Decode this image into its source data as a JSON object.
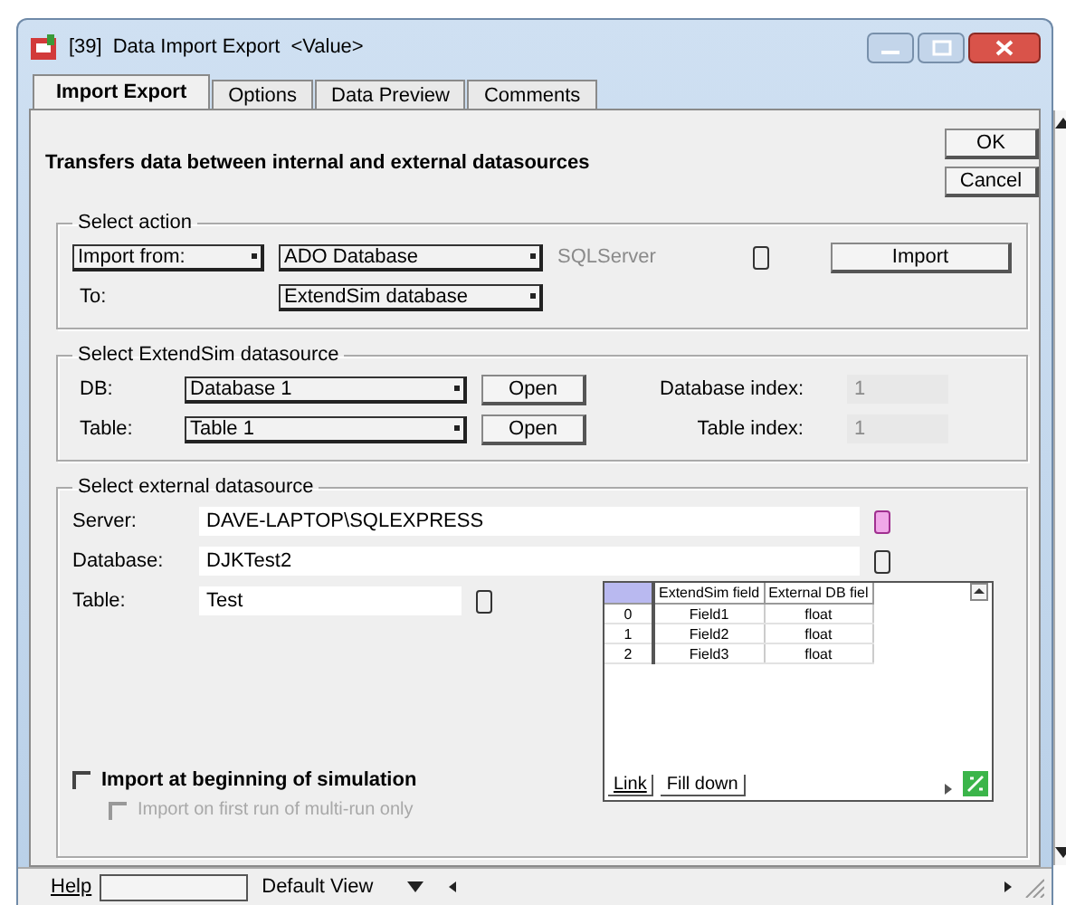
{
  "window": {
    "block_number": "[39]",
    "title": "Data Import Export",
    "value_label": "<Value>"
  },
  "tabs": [
    {
      "label": "Import Export",
      "selected": true
    },
    {
      "label": "Options",
      "selected": false
    },
    {
      "label": "Data Preview",
      "selected": false
    },
    {
      "label": "Comments",
      "selected": false
    }
  ],
  "description": "Transfers data between internal and external datasources",
  "buttons": [
    "OK",
    "Cancel"
  ],
  "select_action": {
    "title": "Select action",
    "import_from": "Import from:",
    "source": "ADO Database",
    "source_type": "SQLServer",
    "action_button": "Import",
    "to_label": "To:",
    "destination": "ExtendSim database"
  },
  "extendsim_datasource": {
    "title": "Select ExtendSim datasource",
    "rows": [
      {
        "label": "DB:",
        "value": "Database 1",
        "button": "Open",
        "index_label": "Database index:",
        "index_value": "1"
      },
      {
        "label": "Table:",
        "value": "Table 1",
        "button": "Open",
        "index_label": "Table index:",
        "index_value": "1"
      }
    ]
  },
  "external_datasource": {
    "title": "Select external datasource",
    "fields": [
      {
        "label": "Server:",
        "value": "DAVE-LAPTOP\\SQLEXPRESS"
      },
      {
        "label": "Database:",
        "value": "DJKTest2"
      },
      {
        "label": "Table:",
        "value": "Test"
      }
    ],
    "mapping_table": {
      "columns": [
        "",
        "ExtendSim field",
        "External DB fiel"
      ],
      "rows": [
        [
          "0",
          "Field1",
          "float"
        ],
        [
          "1",
          "Field2",
          "float"
        ],
        [
          "2",
          "Field3",
          "float"
        ]
      ]
    },
    "table_buttons": [
      "Link",
      "Fill down"
    ],
    "checkboxes": [
      {
        "label": "Import at beginning of simulation",
        "checked": false,
        "disabled": false
      },
      {
        "label": "Import on first run of multi-run only",
        "checked": false,
        "disabled": true
      }
    ]
  },
  "status_bar": {
    "help": "Help",
    "view": "Default View"
  }
}
